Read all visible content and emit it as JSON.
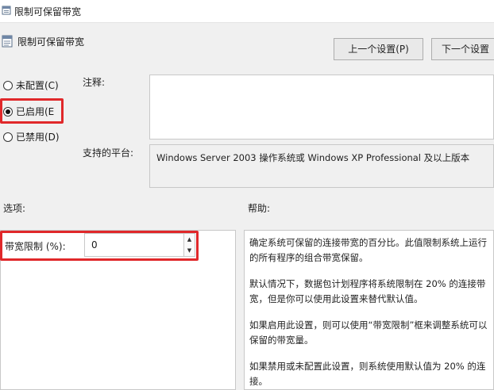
{
  "window": {
    "title": "限制可保留带宽"
  },
  "header": {
    "title": "限制可保留带宽"
  },
  "nav": {
    "prev_label": "上一个设置(P)",
    "next_label": "下一个设置"
  },
  "state": {
    "options": [
      {
        "label": "未配置(C)",
        "checked": false
      },
      {
        "label": "已启用(E",
        "checked": true
      },
      {
        "label": "已禁用(D)",
        "checked": false
      }
    ]
  },
  "comment": {
    "label": "注释:",
    "value": ""
  },
  "supported": {
    "label": "支持的平台:",
    "value": "Windows Server 2003 操作系统或 Windows XP Professional 及以上版本"
  },
  "options_section": {
    "label": "选项:",
    "bandwidth_label": "带宽限制 (%):",
    "bandwidth_value": "0"
  },
  "help_section": {
    "label": "帮助:",
    "paragraphs": [
      "确定系统可保留的连接带宽的百分比。此值限制系统上运行的所有程序的组合带宽保留。",
      "默认情况下，数据包计划程序将系统限制在 20% 的连接带宽，但是你可以使用此设置来替代默认值。",
      "如果启用此设置，则可以使用“带宽限制”框来调整系统可以保留的带宽量。",
      "如果禁用或未配置此设置，则系统使用默认值为 20% 的连接。"
    ]
  },
  "colors": {
    "highlight": "#e0282a",
    "background": "#f0f0f0"
  }
}
